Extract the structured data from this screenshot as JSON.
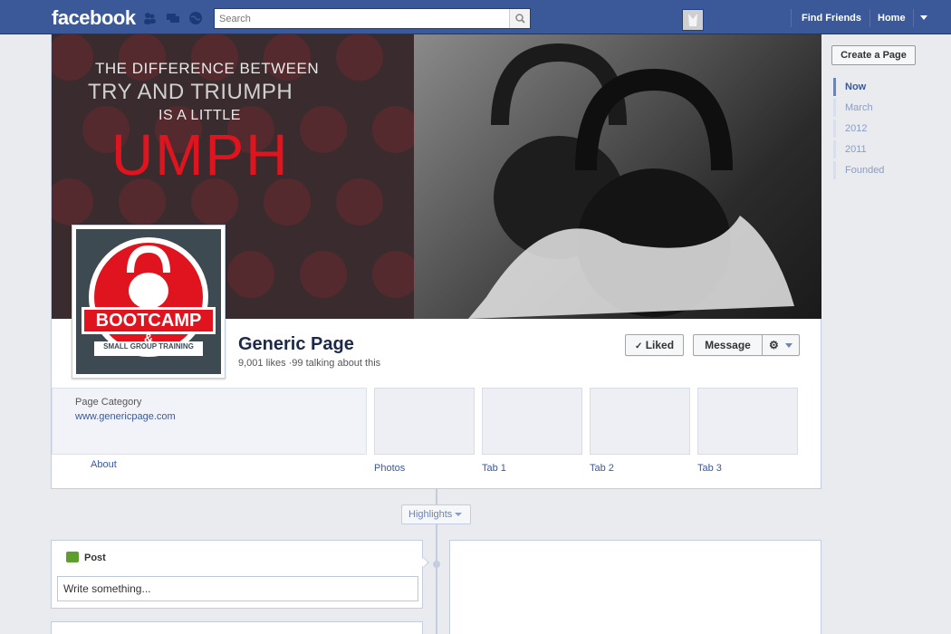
{
  "topbar": {
    "logo": "facebook",
    "search_placeholder": "Search",
    "nav": {
      "find_friends": "Find Friends",
      "home": "Home"
    }
  },
  "cover": {
    "line1": "THE DIFFERENCE BETWEEN",
    "line2": "TRY AND TRIUMPH",
    "line3": "IS A LITTLE",
    "line4": "UMPH"
  },
  "profile": {
    "logo_main": "BOOTCAMP",
    "logo_amp": "&",
    "logo_sub": "SMALL GROUP TRAINING",
    "name": "Generic Page",
    "stats": "9,001 likes ·99 talking about this"
  },
  "actions": {
    "liked": "Liked",
    "message": "Message"
  },
  "about": {
    "category": "Page Category",
    "url": "www.genericpage.com",
    "link": "About"
  },
  "tabs": [
    {
      "label": "Photos"
    },
    {
      "label": "Tab 1"
    },
    {
      "label": "Tab 2"
    },
    {
      "label": "Tab 3"
    }
  ],
  "timeline": {
    "highlights": "Highlights"
  },
  "composer": {
    "label": "Post",
    "placeholder": "Write something..."
  },
  "scrubber": {
    "create_page": "Create a Page",
    "items": [
      {
        "label": "Now",
        "active": true
      },
      {
        "label": "March",
        "active": false
      },
      {
        "label": "2012",
        "active": false
      },
      {
        "label": "2011",
        "active": false
      },
      {
        "label": "Founded",
        "active": false
      }
    ]
  },
  "colors": {
    "brand_blue": "#3b5998",
    "link_blue": "#3b5998",
    "cover_red": "#e0141e"
  }
}
